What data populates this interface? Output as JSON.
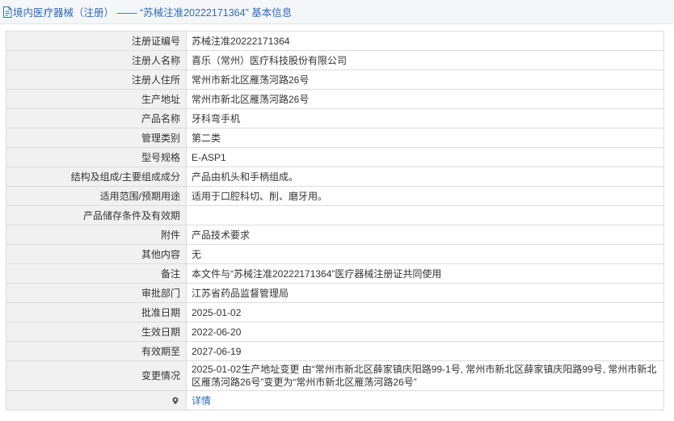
{
  "header": {
    "title": "境内医疗器械（注册） —— “苏械注准20222171364” 基本信息"
  },
  "fields": [
    {
      "label": "注册证编号",
      "value": "苏械注准20222171364"
    },
    {
      "label": "注册人名称",
      "value": "喜乐（常州）医疗科技股份有限公司"
    },
    {
      "label": "注册人住所",
      "value": "常州市新北区雁荡河路26号"
    },
    {
      "label": "生产地址",
      "value": "常州市新北区雁荡河路26号"
    },
    {
      "label": "产品名称",
      "value": "牙科弯手机"
    },
    {
      "label": "管理类别",
      "value": "第二类"
    },
    {
      "label": "型号规格",
      "value": "E-ASP1"
    },
    {
      "label": "结构及组成/主要组成成分",
      "value": "产品由机头和手柄组成。"
    },
    {
      "label": "适用范围/预期用途",
      "value": "适用于口腔科切、削、磨牙用。"
    },
    {
      "label": "产品储存条件及有效期",
      "value": ""
    },
    {
      "label": "附件",
      "value": "产品技术要求"
    },
    {
      "label": "其他内容",
      "value": "无"
    },
    {
      "label": "备注",
      "value": "本文件与“苏械注准20222171364”医疗器械注册证共同使用"
    },
    {
      "label": "审批部门",
      "value": "江苏省药品监督管理局"
    },
    {
      "label": "批准日期",
      "value": "2025-01-02"
    },
    {
      "label": "生效日期",
      "value": "2022-06-20"
    },
    {
      "label": "有效期至",
      "value": "2027-06-19"
    },
    {
      "label": "变更情况",
      "value": "2025-01-02生产地址变更 由“常州市新北区薛家镇庆阳路99-1号, 常州市新北区薛家镇庆阳路99号, 常州市新北区雁荡河路26号”变更为“常州市新北区雁荡河路26号”"
    }
  ],
  "detail_row": {
    "label_icon": "map-pin-icon",
    "link_label": "详情"
  },
  "colors": {
    "title_text": "#2d6db5",
    "label_bg": "#f1f1f1",
    "border": "#dcdcdc"
  }
}
